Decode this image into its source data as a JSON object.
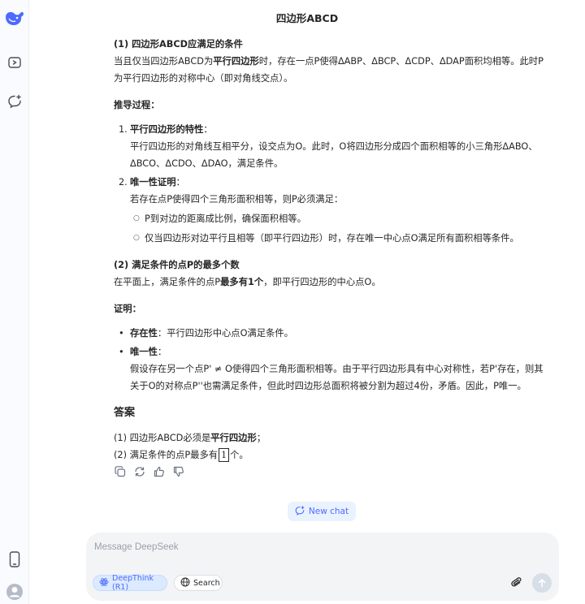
{
  "conversation_title": "四边形ABCD",
  "part1": {
    "heading": "(1) 四边形ABCD应满足的条件",
    "line1_a": "当且仅当四边形ABCD为",
    "line1_b": "平行四边形",
    "line1_c": "时，存在一点P使得ΔABP、ΔBCP、ΔCDP、ΔDAP面积均相等。此时P",
    "line2": "为平行四边形的对称中心（即对角线交点）。"
  },
  "derivation": {
    "heading": "推导过程：",
    "items": [
      {
        "num": "1.",
        "title": "平行四边形的特性",
        "colon": "：",
        "lines": [
          "平行四边形的对角线互相平分，设交点为O。此时，O将四边形分成四个面积相等的小三角形ΔABO、",
          "ΔBCO、ΔCDO、ΔDAO，满足条件。"
        ]
      },
      {
        "num": "2.",
        "title": "唯一性证明",
        "colon": "：",
        "lines": [
          "若存在点P使得四个三角形面积相等，则P必须满足："
        ],
        "sub": [
          "P到对边的距离成比例，确保面积相等。",
          "仅当四边形对边平行且相等（即平行四边形）时，存在唯一中心点O满足所有面积相等条件。"
        ]
      }
    ]
  },
  "part2": {
    "heading": "(2) 满足条件的点P的最多个数",
    "line_a": "在平面上，满足条件的点P",
    "line_b": "最多有1个",
    "line_c": "，即平行四边形的中心点O。"
  },
  "proof": {
    "heading": "证明：",
    "items": [
      {
        "title": "存在性",
        "text": "：平行四边形中心点O满足条件。"
      },
      {
        "title": "唯一性",
        "text": "：",
        "lines": [
          "假设存在另一个点P' ≠ O使得四个三角形面积相等。由于平行四边形具有中心对称性，若P'存在，则其",
          "关于O的对称点P''也需满足条件，但此时四边形总面积将被分割为超过4份，矛盾。因此，P唯一。"
        ]
      }
    ]
  },
  "answer": {
    "heading": "答案",
    "line1_a": "(1) 四边形ABCD必须是",
    "line1_b": "平行四边形",
    "line1_c": "；",
    "line2_a": "(2) 满足条件的点P最多有",
    "line2_box": "1",
    "line2_c": "个。"
  },
  "message_actions": [
    "copy-icon",
    "regenerate-icon",
    "thumbs-up-icon",
    "thumbs-down-icon"
  ],
  "new_chat_label": "New chat",
  "composer": {
    "placeholder": "Message DeepSeek",
    "deepthink_label": "DeepThink (R1)",
    "search_label": "Search"
  },
  "colors": {
    "accent": "#4d6bfe",
    "composer_bg": "#f3f4f6",
    "sidebar_bg": "#f9fbff"
  }
}
